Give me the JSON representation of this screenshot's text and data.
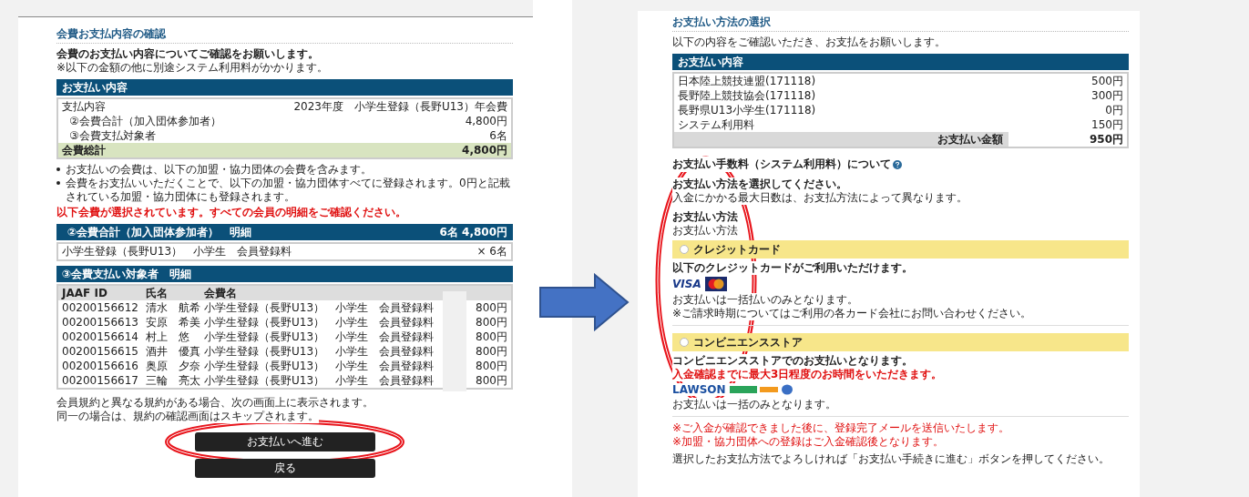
{
  "left_page": {
    "title": "会費お支払内容の確認",
    "intro": "会費のお支払い内容についてご確認をお願いします。",
    "intro_note": "※以下の金額の他に別途システム利用料がかかります。",
    "payment": {
      "header": "お支払い内容",
      "rows": [
        {
          "kind": "plain",
          "label": "支払内容",
          "value": "2023年度　小学生登録（長野U13）年会費"
        },
        {
          "kind": "indent",
          "label": "②会費合計（加入団体参加者）",
          "value": "4,800円"
        },
        {
          "kind": "indent",
          "label": "③会費支払対象者",
          "value": "6名"
        },
        {
          "kind": "total",
          "label": "会費総計",
          "value": "4,800円"
        }
      ]
    },
    "bullets": [
      "お支払いの会費は、以下の加盟・協力団体の会費を含みます。",
      "会費をお支払いいただくことで、以下の加盟・協力団体すべてに登録されます。0円と記載されている加盟・協力団体にも登録されます。"
    ],
    "notice": "以下会費が選択されています。すべての会員の明細をご確認ください。",
    "detail": {
      "header": "②会費合計（加入団体参加者）　明細",
      "header_value": "6名 4,800円",
      "label": "小学生登録（長野U13）　小学生　会員登録料",
      "value": "× 6名"
    },
    "members": {
      "header": "③会費支払い対象者　明細",
      "columns": [
        "JAAF ID",
        "氏名",
        "会費名"
      ],
      "rows": [
        [
          "00200156612",
          "清水　航希",
          "小学生登録（長野U13）　小学生　会員登録料",
          "800円"
        ],
        [
          "00200156613",
          "安原　希美",
          "小学生登録（長野U13）　小学生　会員登録料",
          "800円"
        ],
        [
          "00200156614",
          "村上　悠",
          "小学生登録（長野U13）　小学生　会員登録料",
          "800円"
        ],
        [
          "00200156615",
          "酒井　優真",
          "小学生登録（長野U13）　小学生　会員登録料",
          "800円"
        ],
        [
          "00200156616",
          "奥原　夕奈",
          "小学生登録（長野U13）　小学生　会員登録料",
          "800円"
        ],
        [
          "00200156617",
          "三輪　亮太",
          "小学生登録（長野U13）　小学生　会員登録料",
          "800円"
        ]
      ]
    },
    "footer": [
      "会員規約と異なる規約がある場合、次の画面上に表示されます。",
      "同一の場合は、規約の確認画面はスキップされます。"
    ],
    "buttons": [
      "お支払いへ進む",
      "戻る"
    ]
  },
  "right_page": {
    "title": "お支払い方法の選択",
    "intro": "以下の内容をご確認いただき、お支払をお願いします。",
    "payment": {
      "header": "お支払い内容",
      "rows": [
        {
          "label": "日本陸上競技連盟(171118)",
          "value": "500円"
        },
        {
          "label": "長野陸上競技協会(171118)",
          "value": "300円"
        },
        {
          "label": "長野県U13小学生(171118)",
          "value": "0円"
        },
        {
          "label": "システム利用料",
          "value": "150円"
        }
      ],
      "total_label": "お支払い金額",
      "total_value": "950円"
    },
    "fee_heading": "お支払い手数料（システム利用料）について",
    "select_heading": "お支払い方法を選択してください。",
    "select_note": "入金にかかる最大日数は、お支払方法によって異なります。",
    "methods_heading": "お支払い方法",
    "methods_label": "お支払い方法",
    "methods": [
      {
        "name": "クレジットカード",
        "selected": false,
        "lead": "以下のクレジットカードがご利用いただけます。",
        "logos": {
          "kind": "cards",
          "text": "VISA"
        },
        "notes": [
          "お支払いは一括払いのみとなります。",
          "※ご請求時期についてはご利用の各カード会社にお問い合わせください。"
        ]
      },
      {
        "name": "コンビニエンスストア",
        "selected": false,
        "lead": "コンビニエンスストアでのお支払いとなります。",
        "warning": "入金確認までに最大3日程度のお時間をいただきます。",
        "logos": {
          "kind": "stores",
          "text": "LAWSON"
        },
        "notes": [
          "お支払いは一括のみとなります。"
        ]
      }
    ],
    "red_notes": [
      "※ご入金が確認できました後に、登録完了メールを送信いたします。",
      "※加盟・協力団体への登録はご入金確認後となります。"
    ],
    "closing": "選択したお支払方法でよろしければ「お支払い手続きに進む」ボタンを押してください。"
  }
}
